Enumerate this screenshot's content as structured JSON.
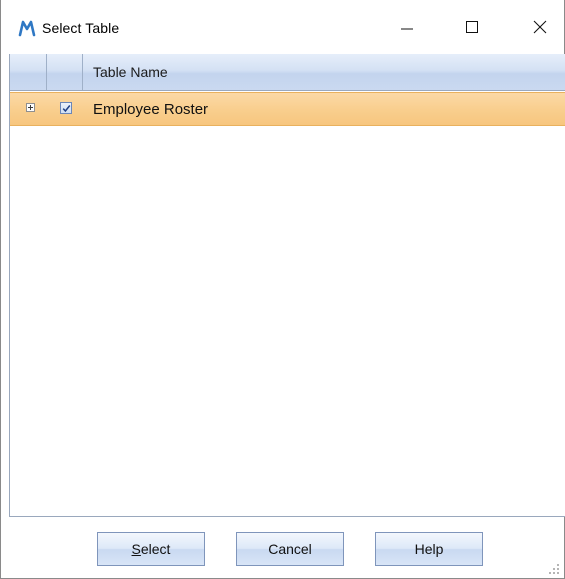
{
  "window": {
    "title": "Select Table",
    "app_icon": "m-logo-icon"
  },
  "title_controls": {
    "minimize_icon": "minimize-icon",
    "maximize_icon": "maximize-icon",
    "close_icon": "close-icon"
  },
  "grid": {
    "columns": [
      "",
      "",
      "Table Name"
    ],
    "rows": [
      {
        "expanded": false,
        "checked": true,
        "name": "Employee Roster",
        "selected": true
      }
    ]
  },
  "buttons": {
    "select_mnemonic": "S",
    "select_rest": "elect",
    "cancel": "Cancel",
    "help": "Help"
  },
  "colors": {
    "header_blue": "#d4e1f4",
    "row_selected": "#f9cf8f",
    "button_blue": "#dde8f8",
    "logo_blue": "#2f78c4"
  }
}
